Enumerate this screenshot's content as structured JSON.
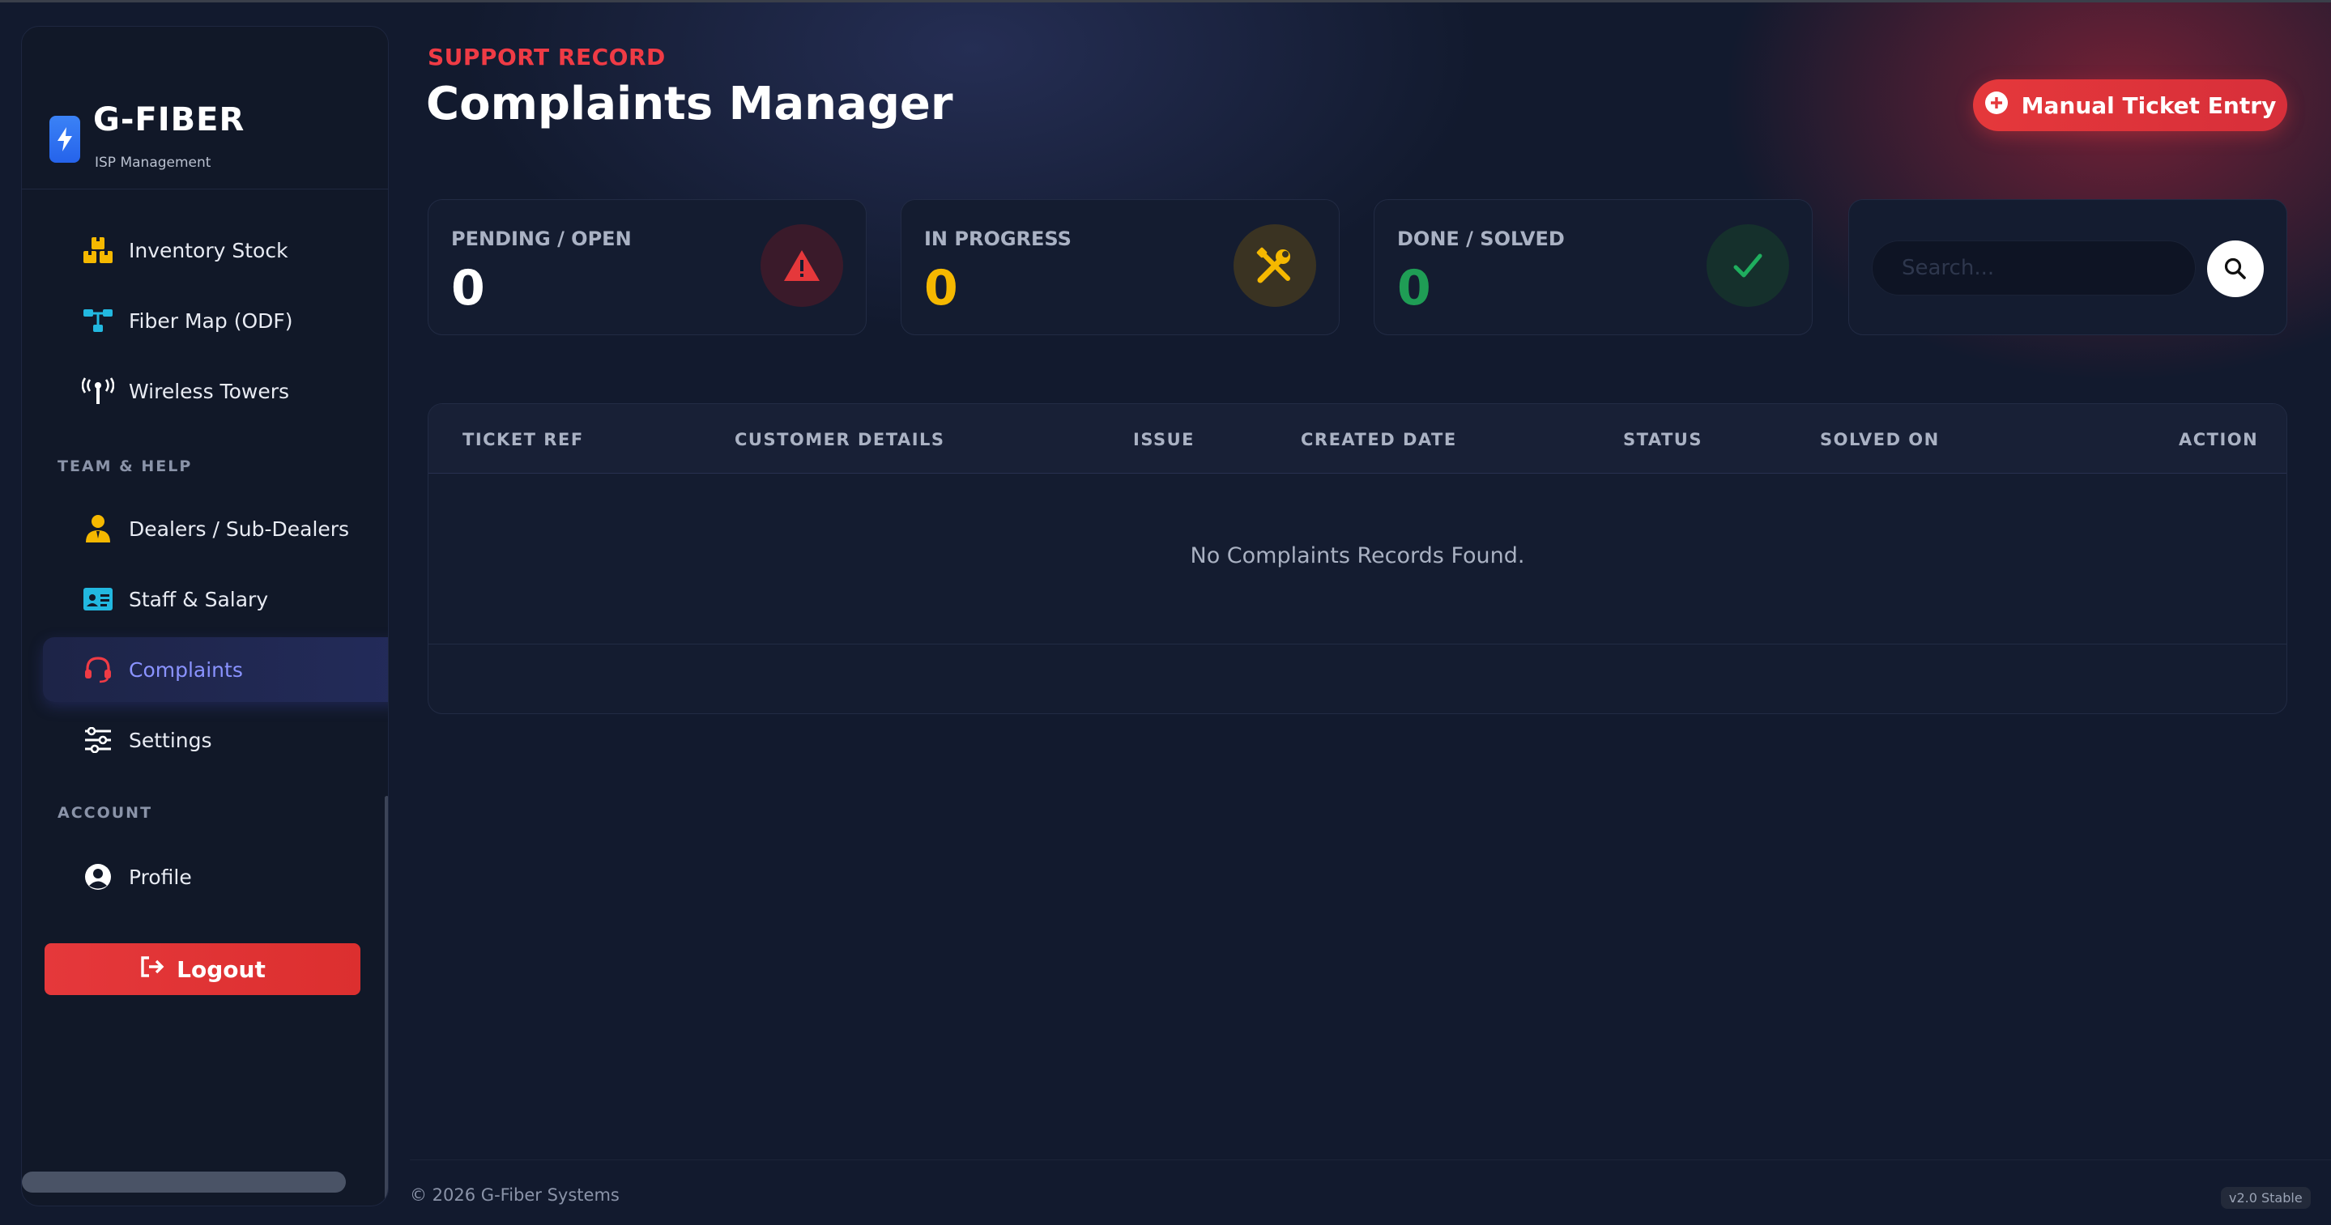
{
  "brand": {
    "name": "G-FIBER",
    "subtitle": "ISP Management"
  },
  "sidebar": {
    "items": [
      {
        "label": "Inventory Stock",
        "icon": "boxes-icon"
      },
      {
        "label": "Fiber Map (ODF)",
        "icon": "network-icon"
      },
      {
        "label": "Wireless Towers",
        "icon": "tower-icon"
      }
    ],
    "section_team": "TEAM & HELP",
    "team_items": [
      {
        "label": "Dealers / Sub-Dealers",
        "icon": "user-tie-icon"
      },
      {
        "label": "Staff & Salary",
        "icon": "id-card-icon"
      },
      {
        "label": "Complaints",
        "icon": "headset-icon",
        "active": true
      },
      {
        "label": "Settings",
        "icon": "sliders-icon"
      }
    ],
    "section_account": "ACCOUNT",
    "account_items": [
      {
        "label": "Profile",
        "icon": "user-circle-icon"
      }
    ],
    "logout_label": "Logout"
  },
  "header": {
    "kicker": "SUPPORT RECORD",
    "title": "Complaints Manager",
    "manual_button": "Manual Ticket Entry"
  },
  "stats": [
    {
      "label": "PENDING / OPEN",
      "value": "0",
      "color": "#ffffff",
      "icon": "warning-icon"
    },
    {
      "label": "IN PROGRESS",
      "value": "0",
      "color": "#f5b800",
      "icon": "tools-icon"
    },
    {
      "label": "DONE / SOLVED",
      "value": "0",
      "color": "#1f9d55",
      "icon": "check-icon"
    }
  ],
  "search": {
    "placeholder": "Search..."
  },
  "table": {
    "columns": [
      "TICKET REF",
      "CUSTOMER DETAILS",
      "ISSUE",
      "CREATED DATE",
      "STATUS",
      "SOLVED ON",
      "ACTION"
    ],
    "empty_message": "No Complaints Records Found."
  },
  "footer": {
    "copyright": "© 2026 G-Fiber Systems",
    "version": "v2.0 Stable"
  },
  "colors": {
    "accent_red": "#e5383b",
    "active_nav": "#8a93ff",
    "background": "#121a2e"
  }
}
